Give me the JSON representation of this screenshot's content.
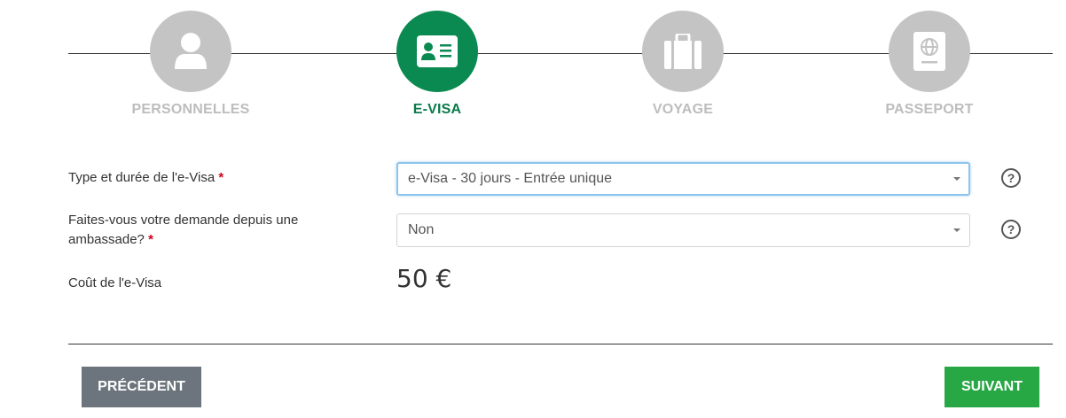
{
  "steps": [
    {
      "label": "PERSONNELLES",
      "icon": "user-icon",
      "active": false
    },
    {
      "label": "E-VISA",
      "icon": "id-card-icon",
      "active": true
    },
    {
      "label": "VOYAGE",
      "icon": "suitcase-icon",
      "active": false
    },
    {
      "label": "PASSEPORT",
      "icon": "passport-icon",
      "active": false
    }
  ],
  "form": {
    "visa_type": {
      "label": "Type et durée de l'e-Visa",
      "required_mark": "*",
      "value": "e-Visa - 30 jours - Entrée unique",
      "help": "?"
    },
    "embassy": {
      "label": "Faites-vous votre demande depuis une ambassade?",
      "required_mark": "*",
      "value": "Non",
      "help": "?"
    },
    "cost": {
      "label": "Coût de l'e-Visa",
      "value": "50 €"
    }
  },
  "buttons": {
    "previous": "PRÉCÉDENT",
    "next": "SUIVANT"
  },
  "colors": {
    "active_step": "#0a8a50",
    "inactive_step": "#c4c4c4",
    "previous_button": "#6c757d",
    "next_button": "#28a745",
    "required": "#d0021b"
  }
}
